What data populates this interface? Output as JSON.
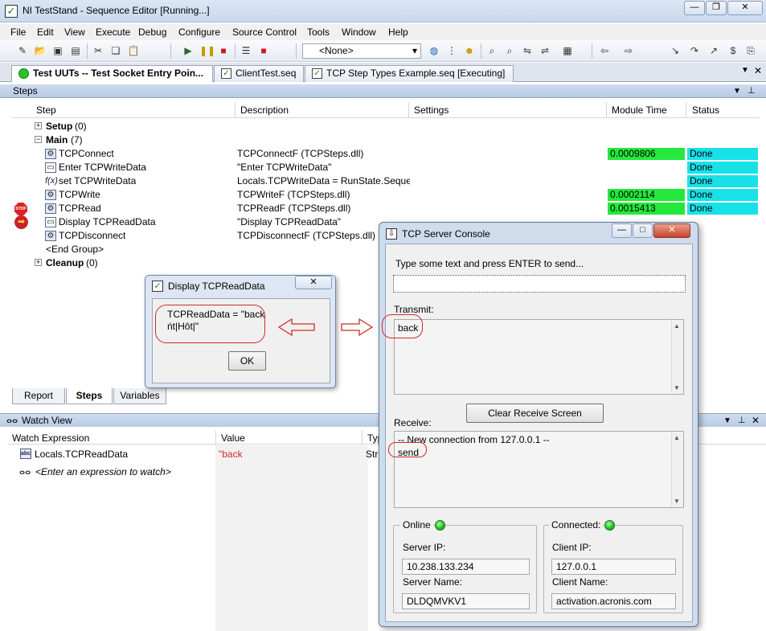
{
  "window": {
    "title": "NI TestStand - Sequence Editor [Running...]"
  },
  "menu": [
    "File",
    "Edit",
    "View",
    "Execute",
    "Debug",
    "Configure",
    "Source Control",
    "Tools",
    "Window",
    "Help"
  ],
  "toolbar": {
    "adapter_value": "<None>"
  },
  "doc_tabs": [
    "Test UUTs -- Test Socket Entry Poin...",
    "ClientTest.seq",
    "TCP Step Types Example.seq [Executing]"
  ],
  "steps_panel": {
    "title": "Steps",
    "columns": [
      "Step",
      "Description",
      "Settings",
      "Module Time",
      "Status"
    ],
    "groups": {
      "setup": {
        "name": "Setup",
        "count": "(0)"
      },
      "main": {
        "name": "Main",
        "count": "(7)"
      },
      "cleanup": {
        "name": "Cleanup",
        "count": "(0)"
      }
    },
    "rows": [
      {
        "step": "TCPConnect",
        "description": "TCPConnectF (TCPSteps.dll)",
        "module_time": "0.0009806",
        "status": "Done"
      },
      {
        "step": "Enter TCPWriteData",
        "description": "\"Enter TCPWriteData\"",
        "module_time": "",
        "status": "Done"
      },
      {
        "step": "set TCPWriteData",
        "description": "Locals.TCPWriteData = RunState.Sequen...",
        "module_time": "",
        "status": "Done"
      },
      {
        "step": "TCPWrite",
        "description": "TCPWriteF (TCPSteps.dll)",
        "module_time": "0.0002114",
        "status": "Done"
      },
      {
        "step": "TCPRead",
        "description": "TCPReadF (TCPSteps.dll)",
        "module_time": "0.0015413",
        "status": "Done"
      },
      {
        "step": "Display TCPReadData",
        "description": "\"Display TCPReadData\"",
        "module_time": "",
        "status": ""
      },
      {
        "step": "TCPDisconnect",
        "description": "TCPDisconnectF (TCPSteps.dll)",
        "module_time": "",
        "status": ""
      },
      {
        "step": "<End Group>",
        "description": "",
        "module_time": "",
        "status": ""
      }
    ],
    "stop_marker": "STOP",
    "bottom_tabs": [
      "Report",
      "Steps",
      "Variables"
    ]
  },
  "watch_view": {
    "title": "Watch View",
    "columns": [
      "Watch Expression",
      "Value",
      "Typ"
    ],
    "rows": [
      {
        "expression": "Locals.TCPReadData",
        "value": "\"back",
        "type": "Stri"
      }
    ],
    "add_hint": "<Enter an expression to watch>"
  },
  "display_dialog": {
    "title": "Display TCPReadData",
    "message_line1": "TCPReadData = \"back",
    "message_line2": "ńt|Hôt|\"",
    "ok_label": "OK"
  },
  "tcp_console": {
    "title": "TCP Server Console",
    "prompt": "Type some text and press ENTER to send...",
    "input_value": "",
    "transmit_label": "Transmit:",
    "transmit_text": "back",
    "clear_button": "Clear Receive Screen",
    "receive_label": "Receive:",
    "receive_line1": "-- New connection from 127.0.0.1 --",
    "receive_line2": "send",
    "online": {
      "label": "Online",
      "server_ip_label": "Server IP:",
      "server_ip": "10.238.133.234",
      "server_name_label": "Server Name:",
      "server_name": "DLDQMVKV1"
    },
    "connected": {
      "label": "Connected:",
      "client_ip_label": "Client IP:",
      "client_ip": "127.0.0.1",
      "client_name_label": "Client Name:",
      "client_name": "activation.acronis.com"
    }
  },
  "colors": {
    "module_time_bg": "#25e83c",
    "status_bg": "#18e2e8",
    "annotation": "#d12a2a"
  }
}
